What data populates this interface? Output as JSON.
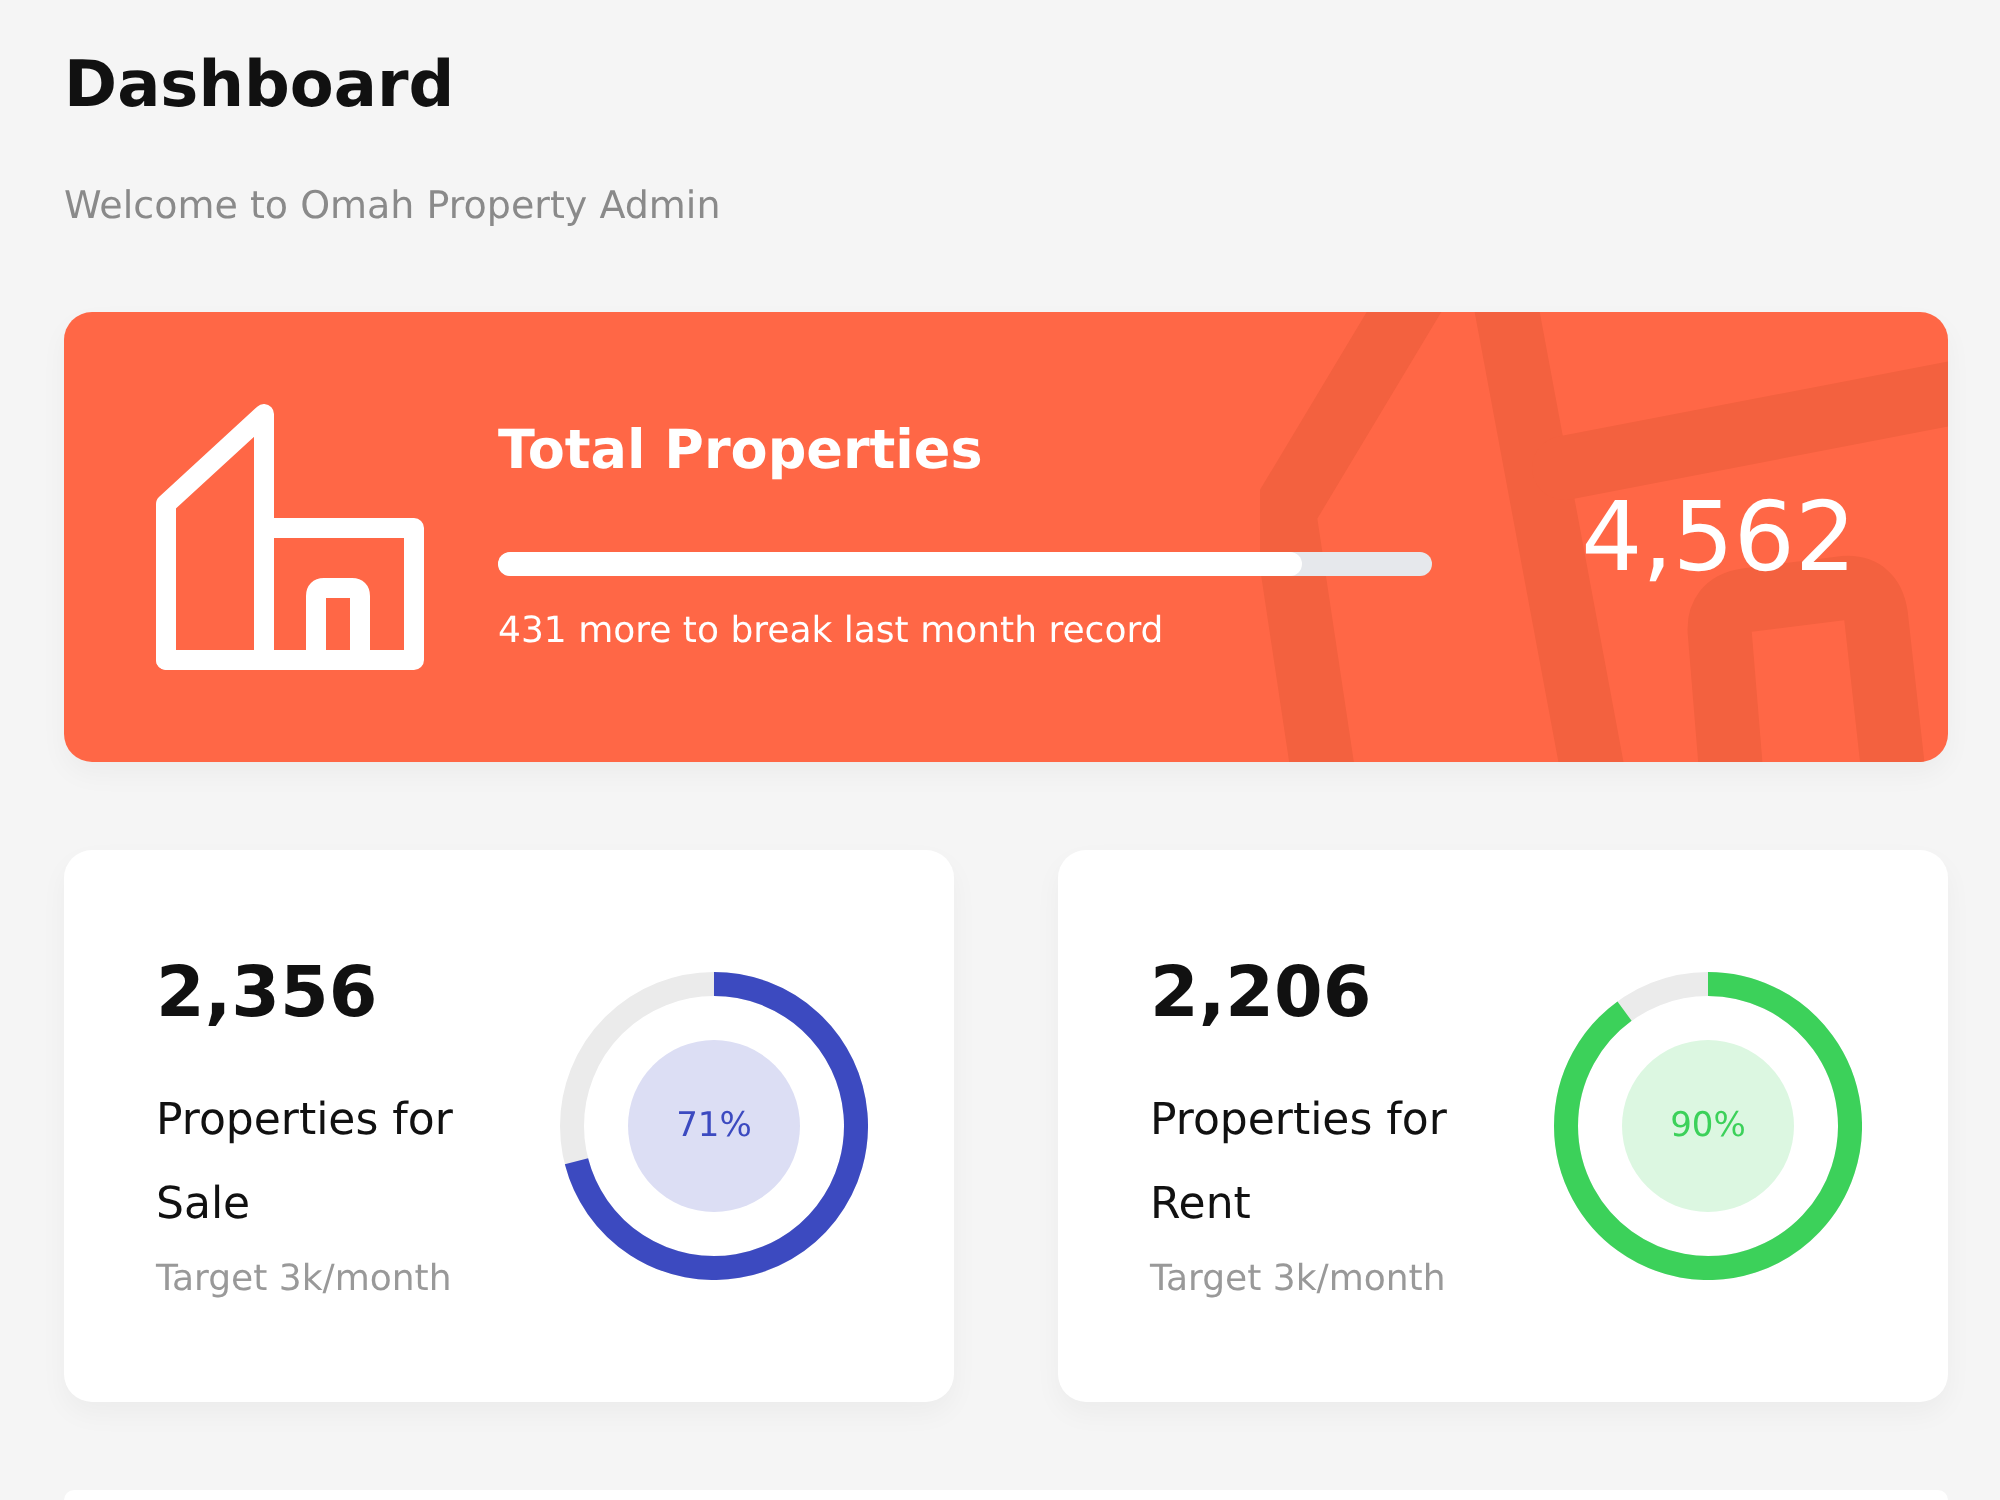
{
  "header": {
    "title": "Dashboard",
    "subtitle": "Welcome to Omah Property Admin"
  },
  "banner": {
    "title": "Total Properties",
    "progress": {
      "level": 0.86
    },
    "note": "431 more to break last month record",
    "value": "4,562"
  },
  "stat_cards": [
    {
      "value": "2,356",
      "label": "Properties for Sale",
      "target": "Target 3k/month",
      "color": "#3c4ac0",
      "ring": {
        "level": 0.71,
        "reading": "71%"
      }
    },
    {
      "value": "2,206",
      "label": "Properties for Rent",
      "target": "Target 3k/month",
      "color": "#3cd15a",
      "ring": {
        "level": 0.9,
        "reading": "90%"
      }
    }
  ]
}
